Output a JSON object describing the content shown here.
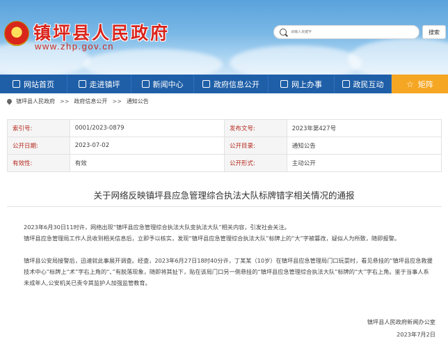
{
  "header": {
    "site_name": "镇坪县人民政府",
    "site_url": "www.zhp.gov.cn",
    "search_placeholder": "请输入关键字",
    "search_button": "搜索"
  },
  "nav": {
    "items": [
      {
        "label": "网站首页",
        "icon": "home-icon"
      },
      {
        "label": "走进镇坪",
        "icon": "building-icon"
      },
      {
        "label": "新闻中心",
        "icon": "news-icon"
      },
      {
        "label": "政府信息公开",
        "icon": "document-icon"
      },
      {
        "label": "网上办事",
        "icon": "computer-icon"
      },
      {
        "label": "政民互动",
        "icon": "people-icon"
      },
      {
        "label": "矩阵",
        "icon": "star-icon"
      }
    ],
    "highlight_color": "#f5a623",
    "bar_color": "#1f5fa8"
  },
  "breadcrumb": {
    "items": [
      "镇坪县人民政府",
      "政府信息公开",
      "通知公告"
    ],
    "separator": ">>"
  },
  "info": {
    "index_label": "索引号:",
    "index_value": "0001/2023-0879",
    "doc_no_label": "发布文号:",
    "doc_no_value": "2023年第427号",
    "date_label": "公开日期:",
    "date_value": "2023-07-02",
    "catalog_label": "公开目录:",
    "catalog_value": "通知公告",
    "validity_label": "有效性:",
    "validity_value": "有效",
    "form_label": "公开形式:",
    "form_value": "主动公开"
  },
  "article": {
    "title": "关于网络反映镇坪县应急管理综合执法大队标牌错字相关情况的通报",
    "p1": "2023年6月30日11时许，网络出现“镇坪县应急管理综合执法大队变执法大队”相关内容，引发社会关注。",
    "p2": "镇坪县应急管理局工作人员收到相关信息后，立即予以核实，发现“镇坪县应急管理综合执法大队”标牌上的“大”字被篡改，疑似人为所致，随即报警。",
    "p3": "镇坪县公安局接警后，迅速就此事展开调查。经查，2023年6月27日18时40分许，丁某某（10岁）在镇坪县应急管理局门口玩耍时，看见悬挂的“镇坪县应急救援技术中心”标牌上“术”字右上角的“、”有脱落现象，随即将其扯下，贴在该局门口另一侧悬挂的“镇坪县应急管理综合执法大队”标牌的“大”字右上角。鉴于当事人系未成年人,公安机关已责令其监护人加强监管教育。",
    "signer": "镇坪县人民政府新闻办公室",
    "sign_date": "2023年7月2日"
  }
}
